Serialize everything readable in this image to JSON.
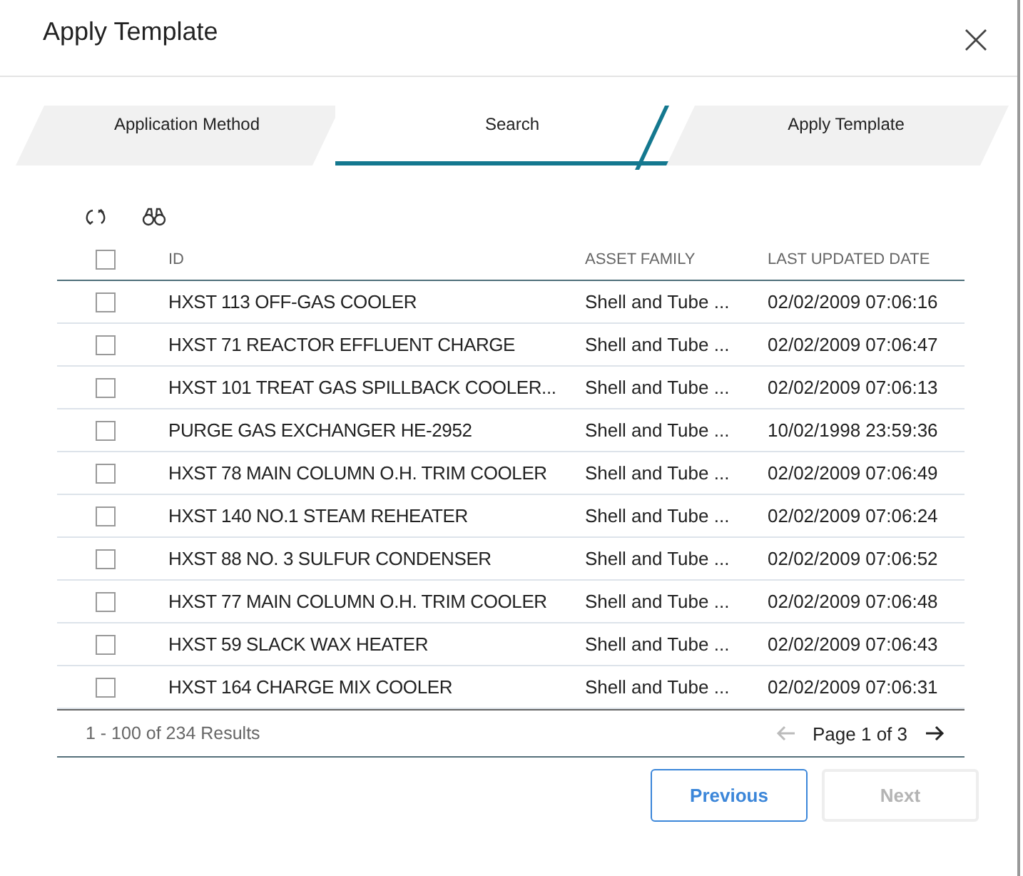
{
  "dialog": {
    "title": "Apply Template"
  },
  "tabs": [
    {
      "label": "Application Method",
      "selected": false
    },
    {
      "label": "Search",
      "selected": true
    },
    {
      "label": "Apply Template",
      "selected": false
    }
  ],
  "table": {
    "select_all": {
      "checked": false
    },
    "columns": [
      "ID",
      "ASSET FAMILY",
      "LAST UPDATED DATE"
    ],
    "rows": [
      {
        "checked": false,
        "cells": [
          "HXST 113 OFF-GAS COOLER",
          "Shell and Tube ...",
          "02/02/2009 07:06:16"
        ]
      },
      {
        "checked": false,
        "cells": [
          "HXST 71 REACTOR EFFLUENT CHARGE",
          "Shell and Tube ...",
          "02/02/2009 07:06:47"
        ]
      },
      {
        "checked": false,
        "cells": [
          "HXST 101 TREAT GAS SPILLBACK COOLER...",
          "Shell and Tube ...",
          "02/02/2009 07:06:13"
        ]
      },
      {
        "checked": false,
        "cells": [
          "PURGE GAS EXCHANGER HE-2952",
          "Shell and Tube ...",
          "10/02/1998 23:59:36"
        ]
      },
      {
        "checked": false,
        "cells": [
          "HXST 78 MAIN COLUMN O.H. TRIM COOLER",
          "Shell and Tube ...",
          "02/02/2009 07:06:49"
        ]
      },
      {
        "checked": false,
        "cells": [
          "HXST 140 NO.1 STEAM REHEATER",
          "Shell and Tube ...",
          "02/02/2009 07:06:24"
        ]
      },
      {
        "checked": false,
        "cells": [
          "HXST 88 NO. 3 SULFUR CONDENSER",
          "Shell and Tube ...",
          "02/02/2009 07:06:52"
        ]
      },
      {
        "checked": false,
        "cells": [
          "HXST 77 MAIN COLUMN O.H. TRIM COOLER",
          "Shell and Tube ...",
          "02/02/2009 07:06:48"
        ]
      },
      {
        "checked": false,
        "cells": [
          "HXST 59 SLACK WAX HEATER",
          "Shell and Tube ...",
          "02/02/2009 07:06:43"
        ]
      },
      {
        "checked": false,
        "cells": [
          "HXST 164 CHARGE MIX COOLER",
          "Shell and Tube ...",
          "02/02/2009 07:06:31"
        ]
      }
    ]
  },
  "footer": {
    "results": "1 - 100 of 234 Results",
    "page": "Page 1 of 3",
    "prev_disabled": true,
    "next_disabled": false
  },
  "buttons": [
    {
      "label": "Previous",
      "disabled": false
    },
    {
      "label": "Next",
      "disabled": true
    }
  ]
}
